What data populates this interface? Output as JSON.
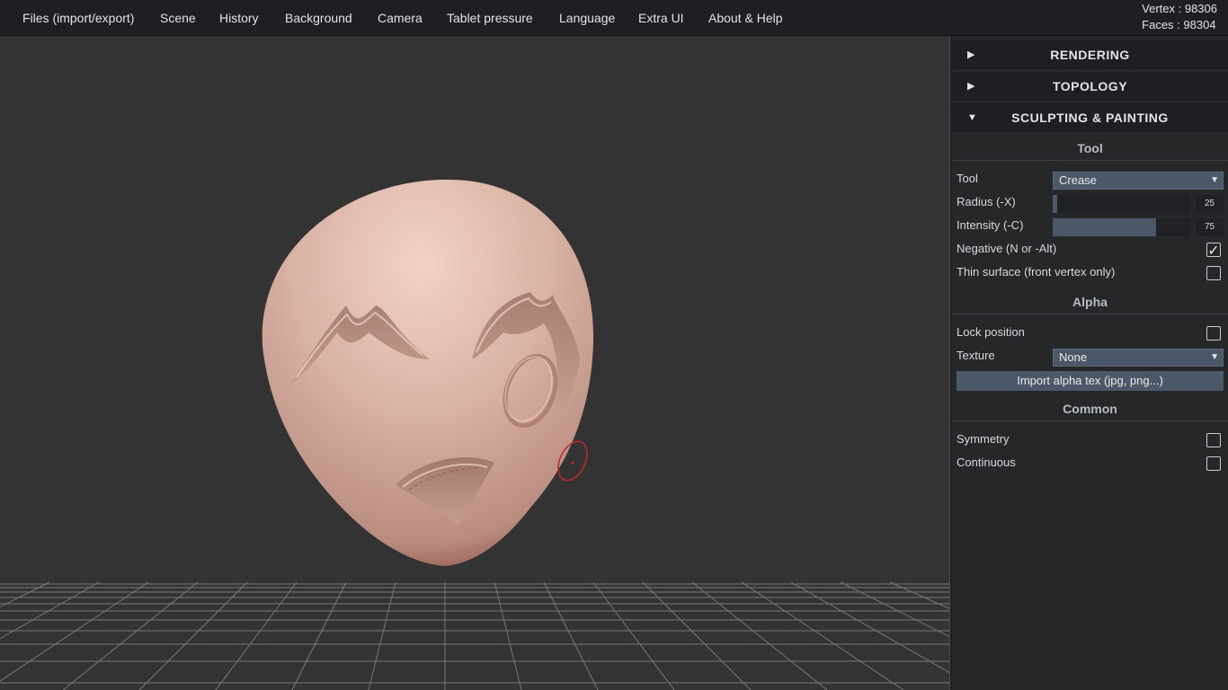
{
  "menubar": {
    "items": [
      {
        "label": "Files (import/export)"
      },
      {
        "label": "Scene"
      },
      {
        "label": "History"
      },
      {
        "label": "Background"
      },
      {
        "label": "Camera"
      },
      {
        "label": "Tablet pressure"
      },
      {
        "label": "Language"
      },
      {
        "label": "Extra UI"
      },
      {
        "label": "About & Help"
      }
    ]
  },
  "stats": {
    "vertex": "Vertex : 98306",
    "faces": "Faces : 98304"
  },
  "panel": {
    "folders": [
      {
        "label": "RENDERING",
        "arrow": "▶",
        "expanded": false
      },
      {
        "label": "TOPOLOGY",
        "arrow": "▶",
        "expanded": false
      },
      {
        "label": "SCULPTING & PAINTING",
        "arrow": "▼",
        "expanded": true
      }
    ],
    "tool_section": {
      "title": "Tool",
      "tool_label": "Tool",
      "tool_value": "Crease",
      "radius_label": "Radius (-X)",
      "radius_value": "25",
      "radius_fraction": 0.03,
      "intensity_label": "Intensity (-C)",
      "intensity_value": "75",
      "intensity_fraction": 0.75,
      "negative_label": "Negative (N or -Alt)",
      "negative_checked": true,
      "thin_label": "Thin surface (front vertex only)",
      "thin_checked": false
    },
    "alpha_section": {
      "title": "Alpha",
      "lock_label": "Lock position",
      "lock_checked": false,
      "texture_label": "Texture",
      "texture_value": "None",
      "import_button": "Import alpha tex (jpg, png...)"
    },
    "common_section": {
      "title": "Common",
      "symmetry_label": "Symmetry",
      "symmetry_checked": false,
      "continuous_label": "Continuous",
      "continuous_checked": false
    }
  },
  "colors": {
    "menubar_bg": "#1d1f22",
    "viewport_bg": "#333333",
    "panel_bg": "#252729",
    "accent": "#4c5867",
    "mesh": "#d9b5a6",
    "brush_cursor": "#c0282a"
  },
  "icons": {
    "collapsed": "triangle-right-icon",
    "expanded": "triangle-down-icon",
    "checkmark": "checkmark-icon",
    "select_caret": "chevron-down-icon"
  }
}
